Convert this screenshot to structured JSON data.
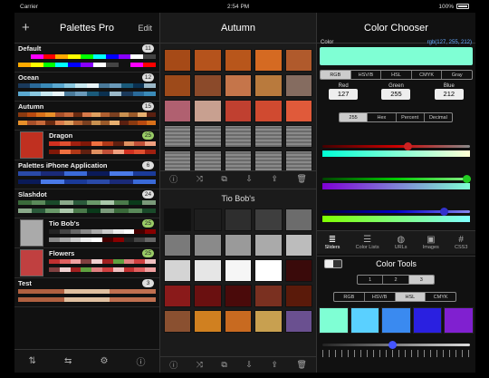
{
  "status": {
    "carrier": "Carrier",
    "time": "2:54 PM",
    "battery": "100%"
  },
  "left": {
    "title": "Palettes Pro",
    "add": "+",
    "edit": "Edit",
    "palettes": [
      {
        "name": "Default",
        "count": "11",
        "green": false,
        "colors": [
          "#111",
          "#f0f",
          "#f00",
          "#fa0",
          "#ff0",
          "#0f0",
          "#0ff",
          "#00f",
          "#80f",
          "#fff",
          "#444"
        ]
      },
      {
        "name": "Ocean",
        "count": "12",
        "green": false,
        "colors": [
          "#1a3a5c",
          "#2a6a9a",
          "#3a8ab8",
          "#5aa8d0",
          "#8ac8e0",
          "#c8e8f0",
          "#e8f4f8",
          "#4a7a9a",
          "#6a9aba",
          "#1a5a7a",
          "#0a3050",
          "#9ab8c8"
        ]
      },
      {
        "name": "Autumn",
        "count": "15",
        "green": false,
        "colors": [
          "#8a3a10",
          "#b84a10",
          "#d8701a",
          "#e8902a",
          "#a8502a",
          "#c86a3a",
          "#6a2a10",
          "#d87a4a",
          "#e0a060",
          "#b06030",
          "#7a4020",
          "#c89050",
          "#9a5a2a",
          "#e8b070",
          "#5a2010"
        ]
      },
      {
        "name": "Dragon",
        "count": "25",
        "green": true,
        "thumb": "#c03020",
        "colors": [
          "#d03020",
          "#e05030",
          "#a02010",
          "#801808",
          "#f07040",
          "#b03818",
          "#602010",
          "#e09060",
          "#c05038",
          "#f0a080"
        ]
      },
      {
        "name": "Palettes iPhone Application",
        "count": "6",
        "green": false,
        "colors": [
          "#2a4aa8",
          "#1a2a78",
          "#3a6ad8",
          "#0a1a58",
          "#4a7ae8",
          "#1a3a98"
        ]
      },
      {
        "name": "Slashdot",
        "count": "24",
        "green": false,
        "colors": [
          "#3a6a3a",
          "#5a8a5a",
          "#1a4a2a",
          "#8aaa8a",
          "#2a5a3a",
          "#6a9a6a",
          "#aac8aa",
          "#4a7a4a",
          "#0a3a1a",
          "#7a9a7a"
        ]
      },
      {
        "name": "Tio Bob's",
        "count": "25",
        "green": true,
        "thumb": "#aaa",
        "colors": [
          "#222",
          "#444",
          "#666",
          "#888",
          "#aaa",
          "#ccc",
          "#eee",
          "#fff",
          "#400",
          "#800"
        ]
      },
      {
        "name": "Flowers",
        "count": "25",
        "green": true,
        "thumb": "#c04040",
        "colors": [
          "#c03030",
          "#e06060",
          "#f0a0a0",
          "#804040",
          "#f0d0d0",
          "#a02020",
          "#60a040",
          "#e08080",
          "#d04040",
          "#f0c0c0"
        ]
      },
      {
        "name": "Test",
        "count": "3",
        "green": false,
        "colors": [
          "#b06040",
          "#e0c0a0",
          "#c07050"
        ]
      }
    ],
    "toolbar": [
      "sort-icon",
      "swap-icon",
      "gear-icon",
      "help-icon"
    ]
  },
  "mid": {
    "title": "Autumn",
    "top_swatches": [
      "#a64a17",
      "#b5531c",
      "#b8561b",
      "#d56a22",
      "#b05a2c",
      "#9d4a1a",
      "#8b4a2a",
      "#c5754a",
      "#b97a3d",
      "#856c60",
      "#b06070",
      "#c8a090",
      "#c04030",
      "#d04a30",
      "#e05a3a",
      "#777",
      "#777",
      "#777",
      "#777",
      "#777",
      "#777",
      "#777",
      "#777",
      "#777",
      "#777"
    ],
    "subtitle": "Tio Bob's",
    "bottom_swatches": [
      "#111",
      "#1e1e1e",
      "#2e2e2e",
      "#3e3e3e",
      "#6c6c6c",
      "#7a7a7a",
      "#8a8a8a",
      "#9a9a9a",
      "#aaaaaa",
      "#bcbcbc",
      "#d4d4d4",
      "#e6e6e6",
      "#f6f6f6",
      "#ffffff",
      "#3a0a0a",
      "#8a1a1a",
      "#6a1010",
      "#4a0a0a",
      "#7a3020",
      "#5a1a0a",
      "#8a5030",
      "#d08020",
      "#c86a20",
      "#c8a050",
      "#6a5090"
    ]
  },
  "right": {
    "title": "Color Chooser",
    "color_label": "Color",
    "color_value": "rgb(127, 255, 212)",
    "current_color": "#7fffd4",
    "modes": [
      "RGB",
      "HSV/B",
      "HSL",
      "CMYK",
      "Gray"
    ],
    "red_label": "Red",
    "green_label": "Green",
    "blue_label": "Blue",
    "red": "127",
    "green": "255",
    "blue": "212",
    "formats": [
      "255",
      "Hex",
      "Percent",
      "Decimal"
    ],
    "tabs": [
      {
        "label": "Sliders",
        "icon": "sliders-icon"
      },
      {
        "label": "Color Lists",
        "icon": "list-icon"
      },
      {
        "label": "URLs",
        "icon": "globe-icon"
      },
      {
        "label": "Images",
        "icon": "image-icon"
      },
      {
        "label": "CSS3",
        "icon": "hash-icon"
      }
    ],
    "tools_title": "Color Tools",
    "counts": [
      "1",
      "2",
      "3"
    ],
    "modes2": [
      "RGB",
      "HSV/B",
      "HSL",
      "CMYK"
    ],
    "tool_swatches": [
      "#7fffd4",
      "#5ad0ff",
      "#3a8af0",
      "#2a20e0",
      "#8020d0"
    ]
  }
}
